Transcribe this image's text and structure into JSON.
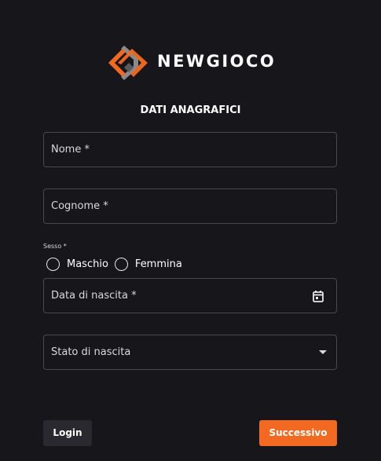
{
  "brand": {
    "name": "NEWGIOCO",
    "colors": {
      "orange": "#f26a21",
      "gray": "#8a898e"
    }
  },
  "form": {
    "title": "DATI ANAGRAFICI",
    "nome_label": "Nome *",
    "cognome_label": "Cognome *",
    "sesso_label": "Sesso *",
    "sesso_options": [
      "Maschio",
      "Femmina"
    ],
    "data_nascita_label": "Data di nascita *",
    "stato_nascita_label": "Stato di nascita"
  },
  "buttons": {
    "login": "Login",
    "next": "Successivo"
  },
  "icons": {
    "date": "calendar-icon",
    "select": "chevron-down-icon"
  }
}
